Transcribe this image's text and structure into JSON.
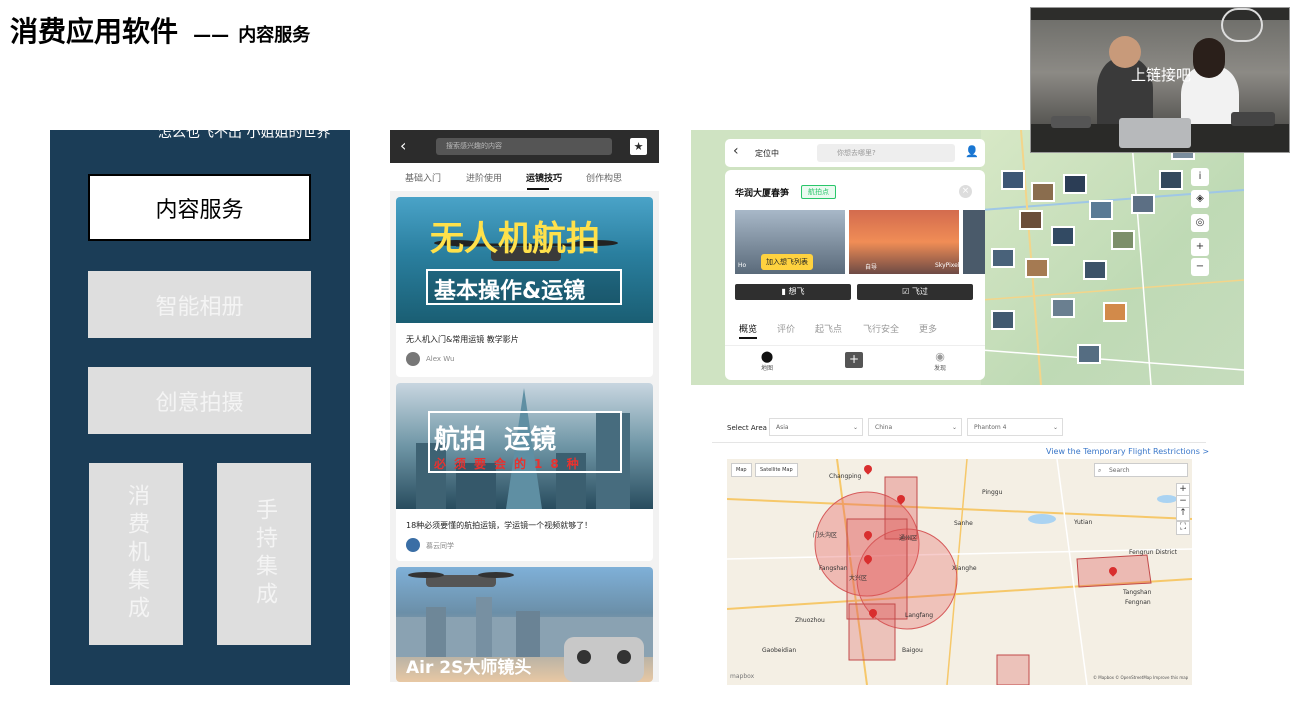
{
  "slide": {
    "title": "消费应用软件",
    "dash": "——",
    "subtitle": "内容服务"
  },
  "left_panel": {
    "cut_text": "怎么也飞不出 小姐姐的世界",
    "items": [
      {
        "label": "内容服务",
        "active": true
      },
      {
        "label": "智能相册",
        "active": false
      },
      {
        "label": "创意拍摄",
        "active": false
      },
      {
        "label": "消费机集成",
        "active": false
      },
      {
        "label": "手持集成",
        "active": false
      }
    ]
  },
  "phone": {
    "search_placeholder": "搜索感兴趣的内容",
    "tabs": [
      "基础入门",
      "进阶使用",
      "运镜技巧",
      "创作构思"
    ],
    "active_tab": "运镜技巧",
    "cards": [
      {
        "banner_line1": "无人机航拍",
        "banner_line2": "基本操作&运镜",
        "title": "无人机入门&常用运镜 教学影片",
        "author": "Alex Wu"
      },
      {
        "banner_line1": "航拍  运镜",
        "banner_line2": "必须要会的18种",
        "title": "18种必须要懂的航拍运镜，学运镜一个视频就够了！",
        "author": "慕云同学"
      },
      {
        "banner_line1": "Air 2S大师镜头",
        "banner_line2": ""
      }
    ]
  },
  "map_app": {
    "location_label": "定位中",
    "search_placeholder": "你想去哪里?",
    "spot_name": "华润大厦春笋",
    "spot_badge": "航拍点",
    "photo_credit_left": "Ho",
    "photo_credit_mid": "自导",
    "photo_credit_right": "SkyPixel",
    "tooltip": "加入想飞列表",
    "btn_want": "想飞",
    "btn_flown": "飞过",
    "tabs": [
      "概览",
      "评价",
      "起飞点",
      "飞行安全",
      "更多"
    ],
    "nav": [
      "地图",
      "",
      "发现"
    ],
    "controls": [
      "i",
      "◈",
      "◎",
      "+",
      "−"
    ]
  },
  "flight_map": {
    "select_label": "Select Area",
    "selects": [
      "Asia",
      "China",
      "Phantom 4"
    ],
    "link": "View the Temporary Flight Restrictions >",
    "map_tabs": [
      "Map",
      "Satellite Map"
    ],
    "search_placeholder": "Search",
    "zoom": [
      "+",
      "−",
      "↑",
      "⛶"
    ],
    "cities": [
      {
        "name": "Changping"
      },
      {
        "name": "门头沟区"
      },
      {
        "name": "通州区"
      },
      {
        "name": "大兴区"
      },
      {
        "name": "Fangshan"
      },
      {
        "name": "Langfang"
      },
      {
        "name": "Pinggu"
      },
      {
        "name": "Sanhe"
      },
      {
        "name": "Xianghe"
      },
      {
        "name": "Tangshan"
      },
      {
        "name": "Fengrun District"
      },
      {
        "name": "Yutian"
      },
      {
        "name": "Zhuozhou"
      },
      {
        "name": "Baigou"
      },
      {
        "name": "Gaobeidian"
      },
      {
        "name": "Fengnan"
      }
    ],
    "attribution": "© Mapbox © OpenStreetMap Improve this map",
    "logo": "mapbox"
  },
  "webcam": {
    "caption": "上链接吧"
  }
}
